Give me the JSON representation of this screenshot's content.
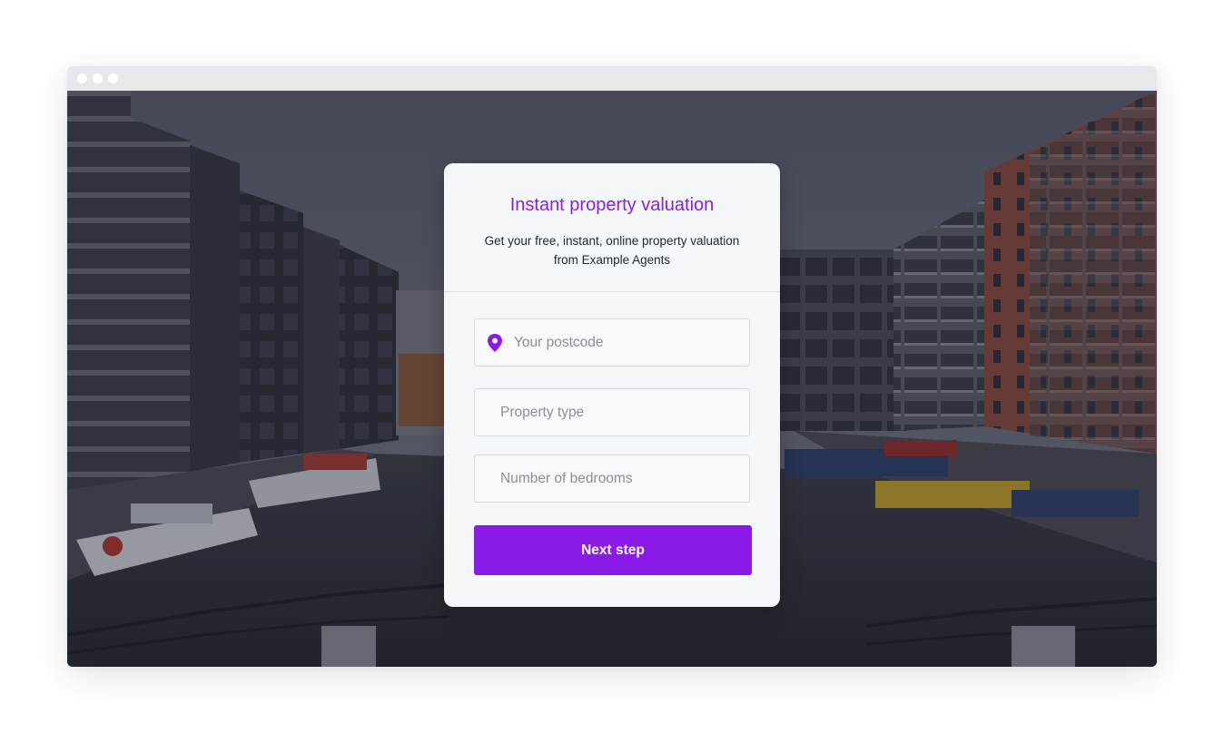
{
  "card": {
    "title": "Instant property valuation",
    "subtitle_line1": "Get your free, instant, online property valuation",
    "subtitle_line2": "from Example Agents"
  },
  "form": {
    "postcode_placeholder": "Your postcode",
    "property_type_placeholder": "Property type",
    "bedrooms_placeholder": "Number of bedrooms",
    "next_label": "Next step"
  },
  "icons": {
    "postcode": "map-pin-icon"
  },
  "colors": {
    "accent": "#8a1ae6",
    "title": "#8a1fe0",
    "card_bg": "#f5f8fb"
  }
}
